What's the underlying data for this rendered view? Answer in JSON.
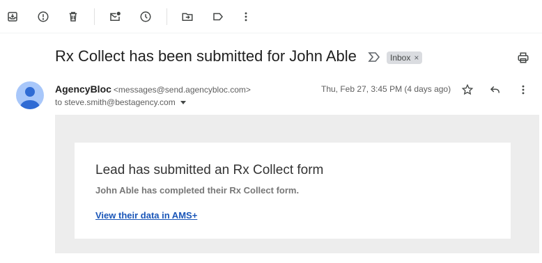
{
  "toolbar": {
    "buttons": [
      {
        "name": "archive-icon",
        "title": "Archive"
      },
      {
        "name": "report-spam-icon",
        "title": "Report spam"
      },
      {
        "name": "delete-icon",
        "title": "Delete"
      },
      {
        "name": "mark-unread-icon",
        "title": "Mark as unread"
      },
      {
        "name": "snooze-icon",
        "title": "Snooze"
      },
      {
        "name": "move-to-icon",
        "title": "Move to"
      },
      {
        "name": "label-icon",
        "title": "Labels"
      },
      {
        "name": "more-vert-icon",
        "title": "More"
      }
    ]
  },
  "message": {
    "subject": "Rx Collect has been submitted for John Able",
    "label": "Inbox",
    "label_remove": "×",
    "sender_name": "AgencyBloc",
    "sender_email": "<messages@send.agencybloc.com>",
    "to": "to steve.smith@bestagency.com",
    "date": "Thu, Feb 27, 3:45 PM (4 days ago)"
  },
  "email_body": {
    "heading": "Lead has submitted an Rx Collect form",
    "subtext": "John Able has completed their Rx Collect form.",
    "link_text": "View their data in AMS+"
  },
  "colors": {
    "avatar_bg": "#a8c7fa",
    "avatar_fg": "#2f6bd4",
    "link": "#1a56b8",
    "email_frame": "#ededed"
  }
}
